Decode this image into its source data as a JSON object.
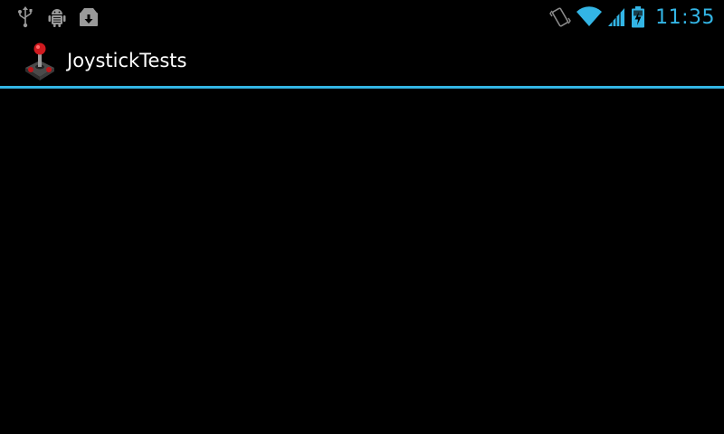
{
  "status_bar": {
    "notification_icons": [
      "usb-icon",
      "android-debug-icon",
      "download-icon"
    ],
    "system_icons": [
      "vibrate-icon",
      "wifi-icon",
      "signal-icon",
      "battery-charging-icon"
    ],
    "time": "11:35",
    "accent_color": "#33b5e5"
  },
  "action_bar": {
    "app_icon": "joystick-icon",
    "title": "JoystickTests",
    "divider_color": "#33b5e5"
  }
}
